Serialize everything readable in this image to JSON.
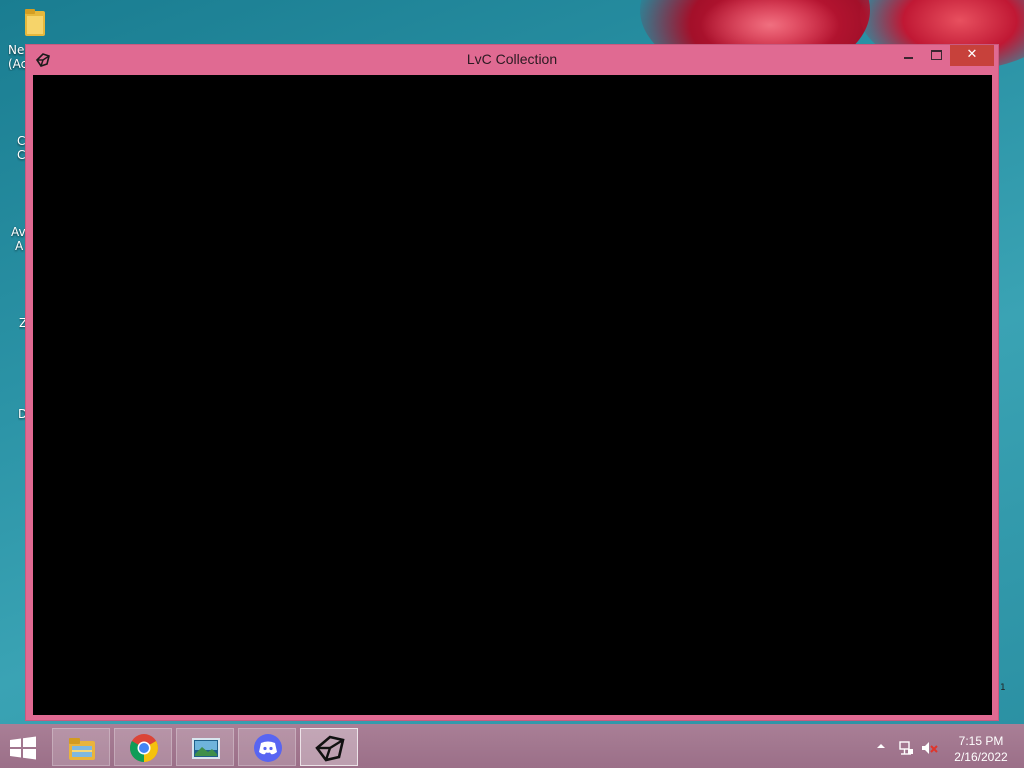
{
  "window": {
    "title": "LvC Collection",
    "close_label": "✕",
    "corner_mark": "1"
  },
  "desktop_icons": [
    {
      "label_line1": "Ne",
      "label_line2": "(Ac"
    },
    {
      "label_line1": "C",
      "label_line2": "C"
    },
    {
      "label_line1": "Av",
      "label_line2": "A"
    },
    {
      "label_line1": "Z",
      "label_line2": ""
    },
    {
      "label_line1": "D",
      "label_line2": ""
    }
  ],
  "taskbar": {
    "items": [
      {
        "name": "file-explorer",
        "icon": "folder-icon"
      },
      {
        "name": "chrome",
        "icon": "chrome-icon"
      },
      {
        "name": "photos",
        "icon": "photos-icon"
      },
      {
        "name": "discord",
        "icon": "discord-icon"
      },
      {
        "name": "unity",
        "icon": "unity-icon",
        "active": true
      }
    ]
  },
  "tray": {
    "time": "7:15 PM",
    "date": "2/16/2022"
  },
  "colors": {
    "window_frame": "#e06a92",
    "close_button": "#c7413b",
    "client_bg": "#000000"
  }
}
